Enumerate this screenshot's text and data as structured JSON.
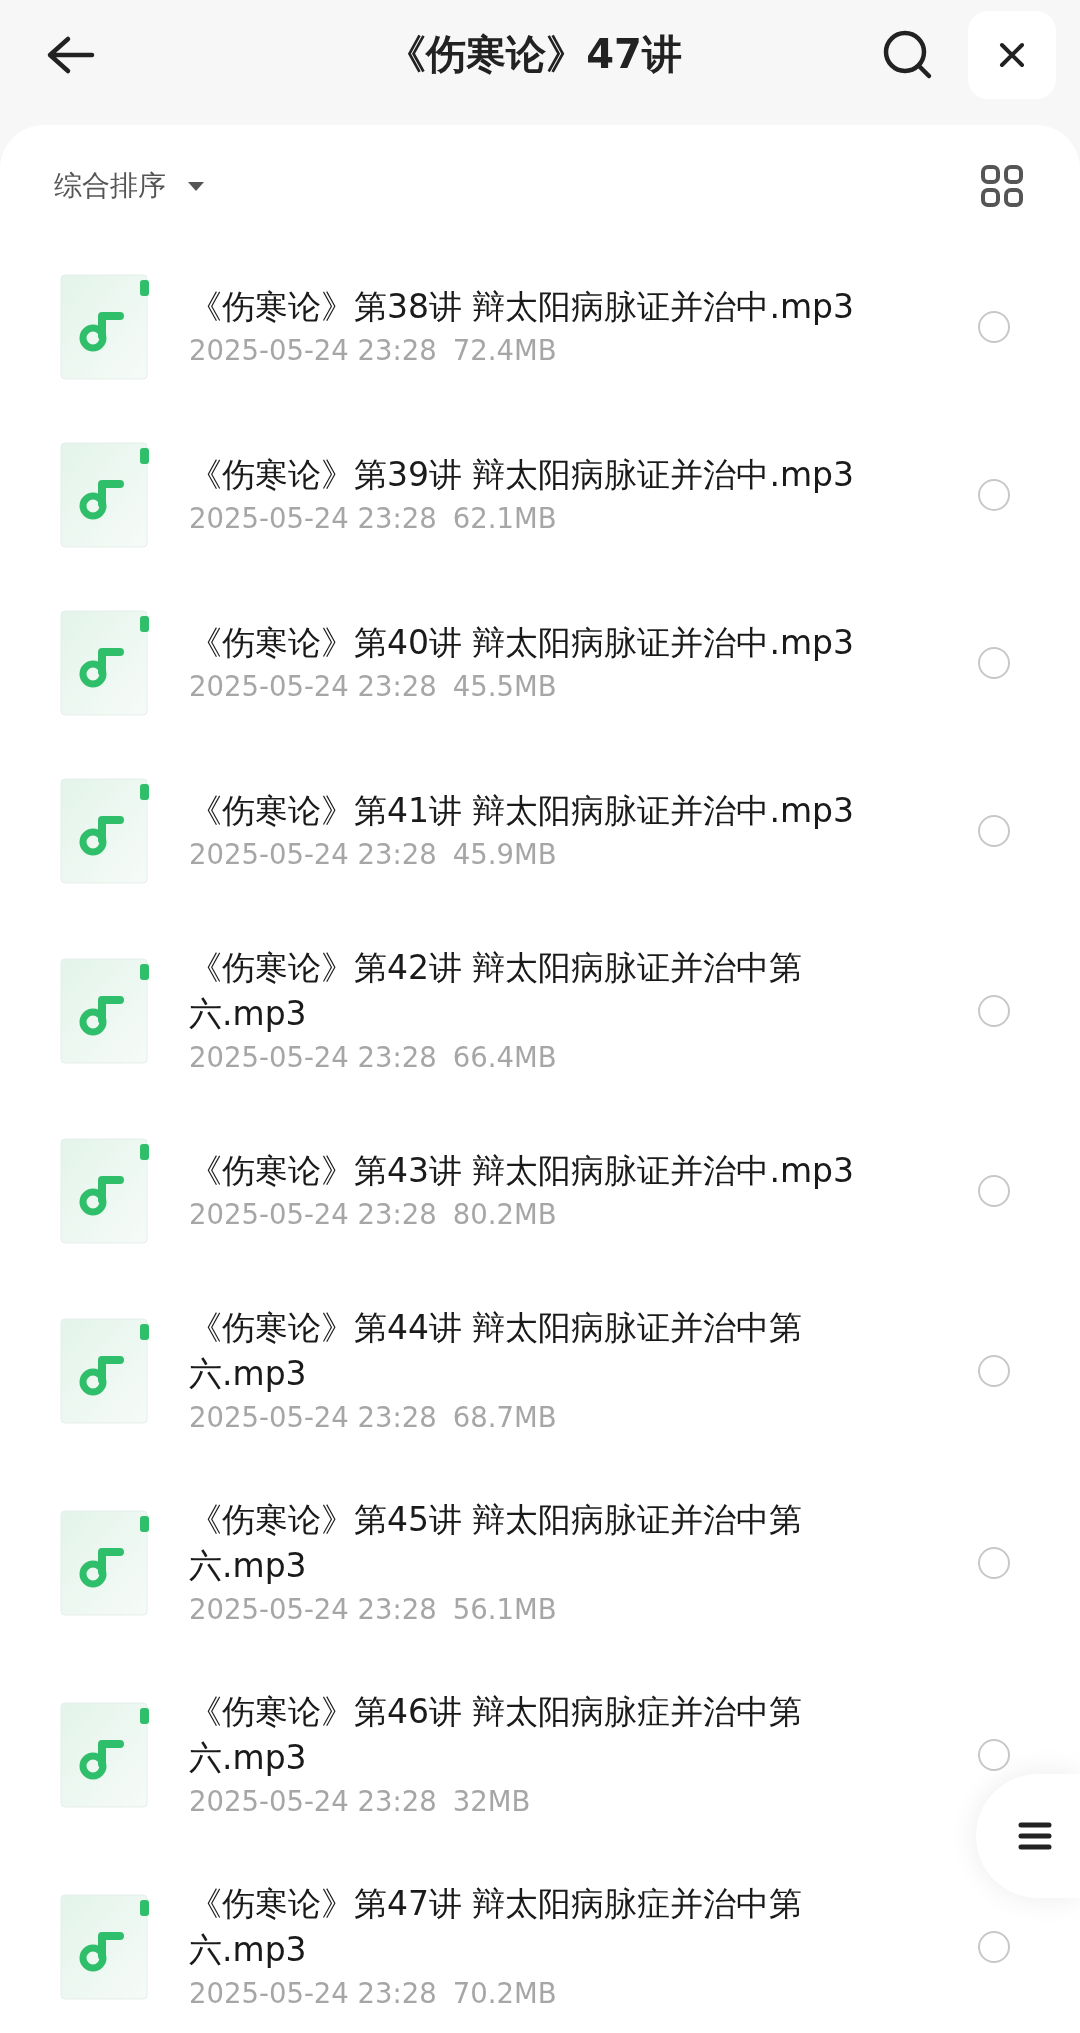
{
  "header": {
    "title": "《伤寒论》47讲"
  },
  "toolbar": {
    "sort_label": "综合排序"
  },
  "files": [
    {
      "name": "《伤寒论》第38讲 辩太阳病脉证并治中.mp3",
      "date": "2025-05-24 23:28",
      "size": "72.4MB",
      "selected": false
    },
    {
      "name": "《伤寒论》第39讲 辩太阳病脉证并治中.mp3",
      "date": "2025-05-24 23:28",
      "size": "62.1MB",
      "selected": false
    },
    {
      "name": "《伤寒论》第40讲 辩太阳病脉证并治中.mp3",
      "date": "2025-05-24 23:28",
      "size": "45.5MB",
      "selected": false
    },
    {
      "name": "《伤寒论》第41讲 辩太阳病脉证并治中.mp3",
      "date": "2025-05-24 23:28",
      "size": "45.9MB",
      "selected": false
    },
    {
      "name": "《伤寒论》第42讲 辩太阳病脉证并治中第六.mp3",
      "date": "2025-05-24 23:28",
      "size": "66.4MB",
      "selected": false
    },
    {
      "name": "《伤寒论》第43讲 辩太阳病脉证并治中.mp3",
      "date": "2025-05-24 23:28",
      "size": "80.2MB",
      "selected": false
    },
    {
      "name": "《伤寒论》第44讲 辩太阳病脉证并治中第六.mp3",
      "date": "2025-05-24 23:28",
      "size": "68.7MB",
      "selected": false
    },
    {
      "name": "《伤寒论》第45讲 辩太阳病脉证并治中第六.mp3",
      "date": "2025-05-24 23:28",
      "size": "56.1MB",
      "selected": false
    },
    {
      "name": "《伤寒论》第46讲 辩太阳病脉症并治中第六.mp3",
      "date": "2025-05-24 23:28",
      "size": "32MB",
      "selected": false
    },
    {
      "name": "《伤寒论》第47讲 辩太阳病脉症并治中第六.mp3",
      "date": "2025-05-24 23:28",
      "size": "70.2MB",
      "selected": false
    }
  ]
}
